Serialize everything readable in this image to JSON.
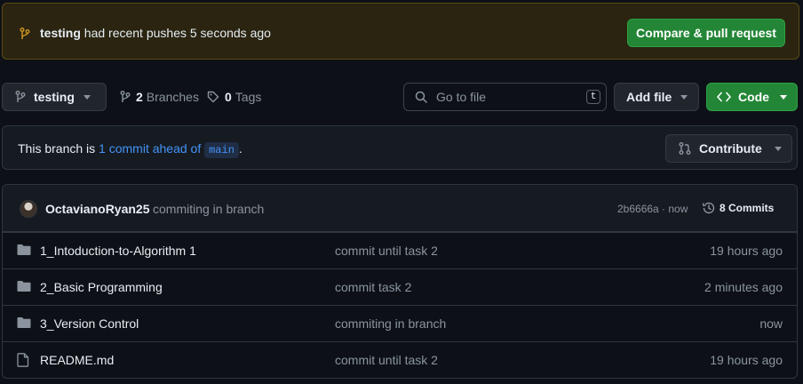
{
  "banner": {
    "branch": "testing",
    "message": "had recent pushes 5 seconds ago",
    "compare_label": "Compare & pull request"
  },
  "toolbar": {
    "branch_label": "testing",
    "branches_count": "2",
    "branches_label": "Branches",
    "tags_count": "0",
    "tags_label": "Tags",
    "search_placeholder": "Go to file",
    "search_shortcut": "t",
    "add_file_label": "Add file",
    "code_label": "Code"
  },
  "ahead_notice": {
    "prefix": "This branch is",
    "link_text": "1 commit ahead of",
    "base_branch": "main",
    "suffix": ".",
    "contribute_label": "Contribute"
  },
  "latest_commit": {
    "author": "OctavianoRyan25",
    "message": "commiting in branch",
    "hash_time": "2b6666a · now",
    "commits_label": "8 Commits"
  },
  "files": [
    {
      "type": "folder",
      "name": "1_Intoduction-to-Algorithm 1",
      "message": "commit until task 2",
      "time": "19 hours ago"
    },
    {
      "type": "folder",
      "name": "2_Basic Programming",
      "message": "commit task 2",
      "time": "2 minutes ago"
    },
    {
      "type": "folder",
      "name": "3_Version Control",
      "message": "commiting in branch",
      "time": "now"
    },
    {
      "type": "file",
      "name": "README.md",
      "message": "commit until task 2",
      "time": "19 hours ago"
    }
  ],
  "colors": {
    "background": "#0d1117",
    "accent_green": "#238636",
    "link_blue": "#4493f8",
    "banner_bg": "#2a2410"
  }
}
